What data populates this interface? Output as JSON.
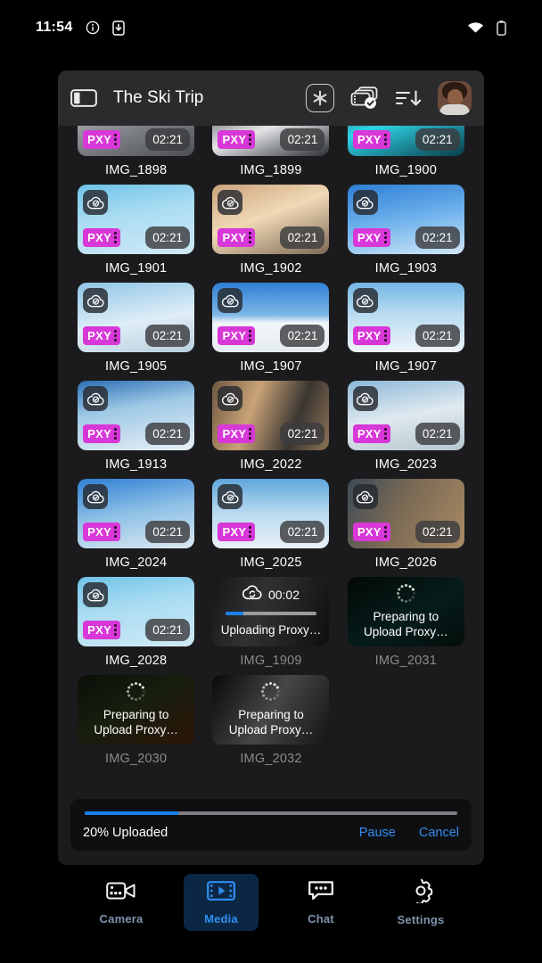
{
  "status_bar": {
    "time": "11:54",
    "icons": [
      "info-icon",
      "download-to-device-icon",
      "wifi-icon",
      "battery-icon"
    ]
  },
  "header": {
    "title": "The Ski Trip",
    "sidebar_toggle_icon": "sidebar-toggle-icon",
    "snowflake_icon": "snowflake-icon",
    "select_media_icon": "select-media-icon",
    "sort_icon": "sort-descending-icon",
    "avatar": "user-avatar"
  },
  "colors": {
    "accent_blue": "#2f8ef0",
    "progress_blue": "#1a80e8",
    "proxy_magenta": "#d838d8",
    "window_bg": "#1b1b1d",
    "header_bg": "#2b2b2d",
    "active_nav_bg": "#0b2744"
  },
  "media": {
    "items": [
      {
        "name": "IMG_1898",
        "state": "uploaded",
        "duration": "02:21",
        "proxy_badge": "PXY",
        "theme": "g1"
      },
      {
        "name": "IMG_1899",
        "state": "uploaded",
        "duration": "02:21",
        "proxy_badge": "PXY",
        "theme": "g2"
      },
      {
        "name": "IMG_1900",
        "state": "uploaded",
        "duration": "02:21",
        "proxy_badge": "PXY",
        "theme": "g3"
      },
      {
        "name": "IMG_1901",
        "state": "uploaded",
        "duration": "02:21",
        "proxy_badge": "PXY",
        "theme": "t1"
      },
      {
        "name": "IMG_1902",
        "state": "uploaded",
        "duration": "02:21",
        "proxy_badge": "PXY",
        "theme": "t2"
      },
      {
        "name": "IMG_1903",
        "state": "uploaded",
        "duration": "02:21",
        "proxy_badge": "PXY",
        "theme": "t3"
      },
      {
        "name": "IMG_1905",
        "state": "uploaded",
        "duration": "02:21",
        "proxy_badge": "PXY",
        "theme": "t4"
      },
      {
        "name": "IMG_1907",
        "state": "uploaded",
        "duration": "02:21",
        "proxy_badge": "PXY",
        "theme": "t5"
      },
      {
        "name": "IMG_1907",
        "state": "uploaded",
        "duration": "02:21",
        "proxy_badge": "PXY",
        "theme": "t6"
      },
      {
        "name": "IMG_1913",
        "state": "uploaded",
        "duration": "02:21",
        "proxy_badge": "PXY",
        "theme": "t7"
      },
      {
        "name": "IMG_2022",
        "state": "uploaded",
        "duration": "02:21",
        "proxy_badge": "PXY",
        "theme": "t8"
      },
      {
        "name": "IMG_2023",
        "state": "uploaded",
        "duration": "02:21",
        "proxy_badge": "PXY",
        "theme": "t9"
      },
      {
        "name": "IMG_2024",
        "state": "uploaded",
        "duration": "02:21",
        "proxy_badge": "PXY",
        "theme": "t10"
      },
      {
        "name": "IMG_2025",
        "state": "uploaded",
        "duration": "02:21",
        "proxy_badge": "PXY",
        "theme": "t11"
      },
      {
        "name": "IMG_2026",
        "state": "uploaded",
        "duration": "02:21",
        "proxy_badge": "PXY",
        "theme": "t12"
      },
      {
        "name": "IMG_2028",
        "state": "uploaded",
        "duration": "02:21",
        "proxy_badge": "PXY",
        "theme": "t1"
      },
      {
        "name": "IMG_1909",
        "state": "uploading",
        "duration": "00:02",
        "label": "Uploading Proxy…",
        "progress": 20,
        "theme": "t13"
      },
      {
        "name": "IMG_2031",
        "state": "preparing",
        "label": "Preparing to Upload Proxy…",
        "theme": "t14"
      },
      {
        "name": "IMG_2030",
        "state": "preparing",
        "label": "Preparing to Upload Proxy…",
        "theme": "t15"
      },
      {
        "name": "IMG_2032",
        "state": "preparing",
        "label": "Preparing to Upload Proxy…",
        "theme": "t16"
      }
    ]
  },
  "upload_status": {
    "progress_text": "20% Uploaded",
    "progress_percent": 20,
    "bar_fill_percent": 25,
    "pause_label": "Pause",
    "cancel_label": "Cancel"
  },
  "bottom_nav": {
    "items": [
      {
        "label": "Camera",
        "icon": "video-camera-icon",
        "active": false
      },
      {
        "label": "Media",
        "icon": "film-play-icon",
        "active": true
      },
      {
        "label": "Chat",
        "icon": "chat-bubble-icon",
        "active": false
      },
      {
        "label": "Settings",
        "icon": "gear-icon",
        "active": false
      }
    ]
  }
}
